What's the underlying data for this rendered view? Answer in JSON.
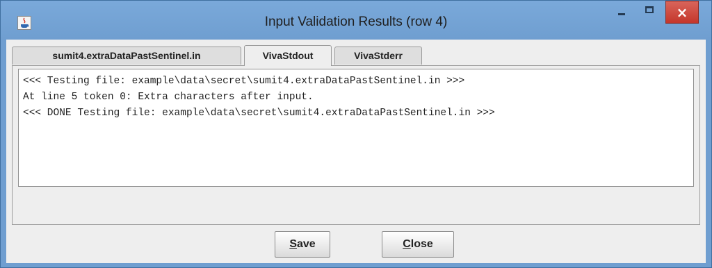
{
  "window": {
    "title": "Input Validation Results (row 4)",
    "minimize_symbol": "-",
    "maximize_symbol": "□",
    "close_symbol": "×"
  },
  "tabs": [
    {
      "label": "sumit4.extraDataPastSentinel.in",
      "active": false
    },
    {
      "label": "VivaStdout",
      "active": true
    },
    {
      "label": "VivaStderr",
      "active": false
    }
  ],
  "output": {
    "lines": [
      "<<< Testing file: example\\data\\secret\\sumit4.extraDataPastSentinel.in >>>",
      "At line 5 token 0: Extra characters after input.",
      "<<< DONE Testing file: example\\data\\secret\\sumit4.extraDataPastSentinel.in >>>"
    ]
  },
  "buttons": {
    "save_mnemonic": "S",
    "save_rest": "ave",
    "close_mnemonic": "C",
    "close_rest": "lose"
  }
}
